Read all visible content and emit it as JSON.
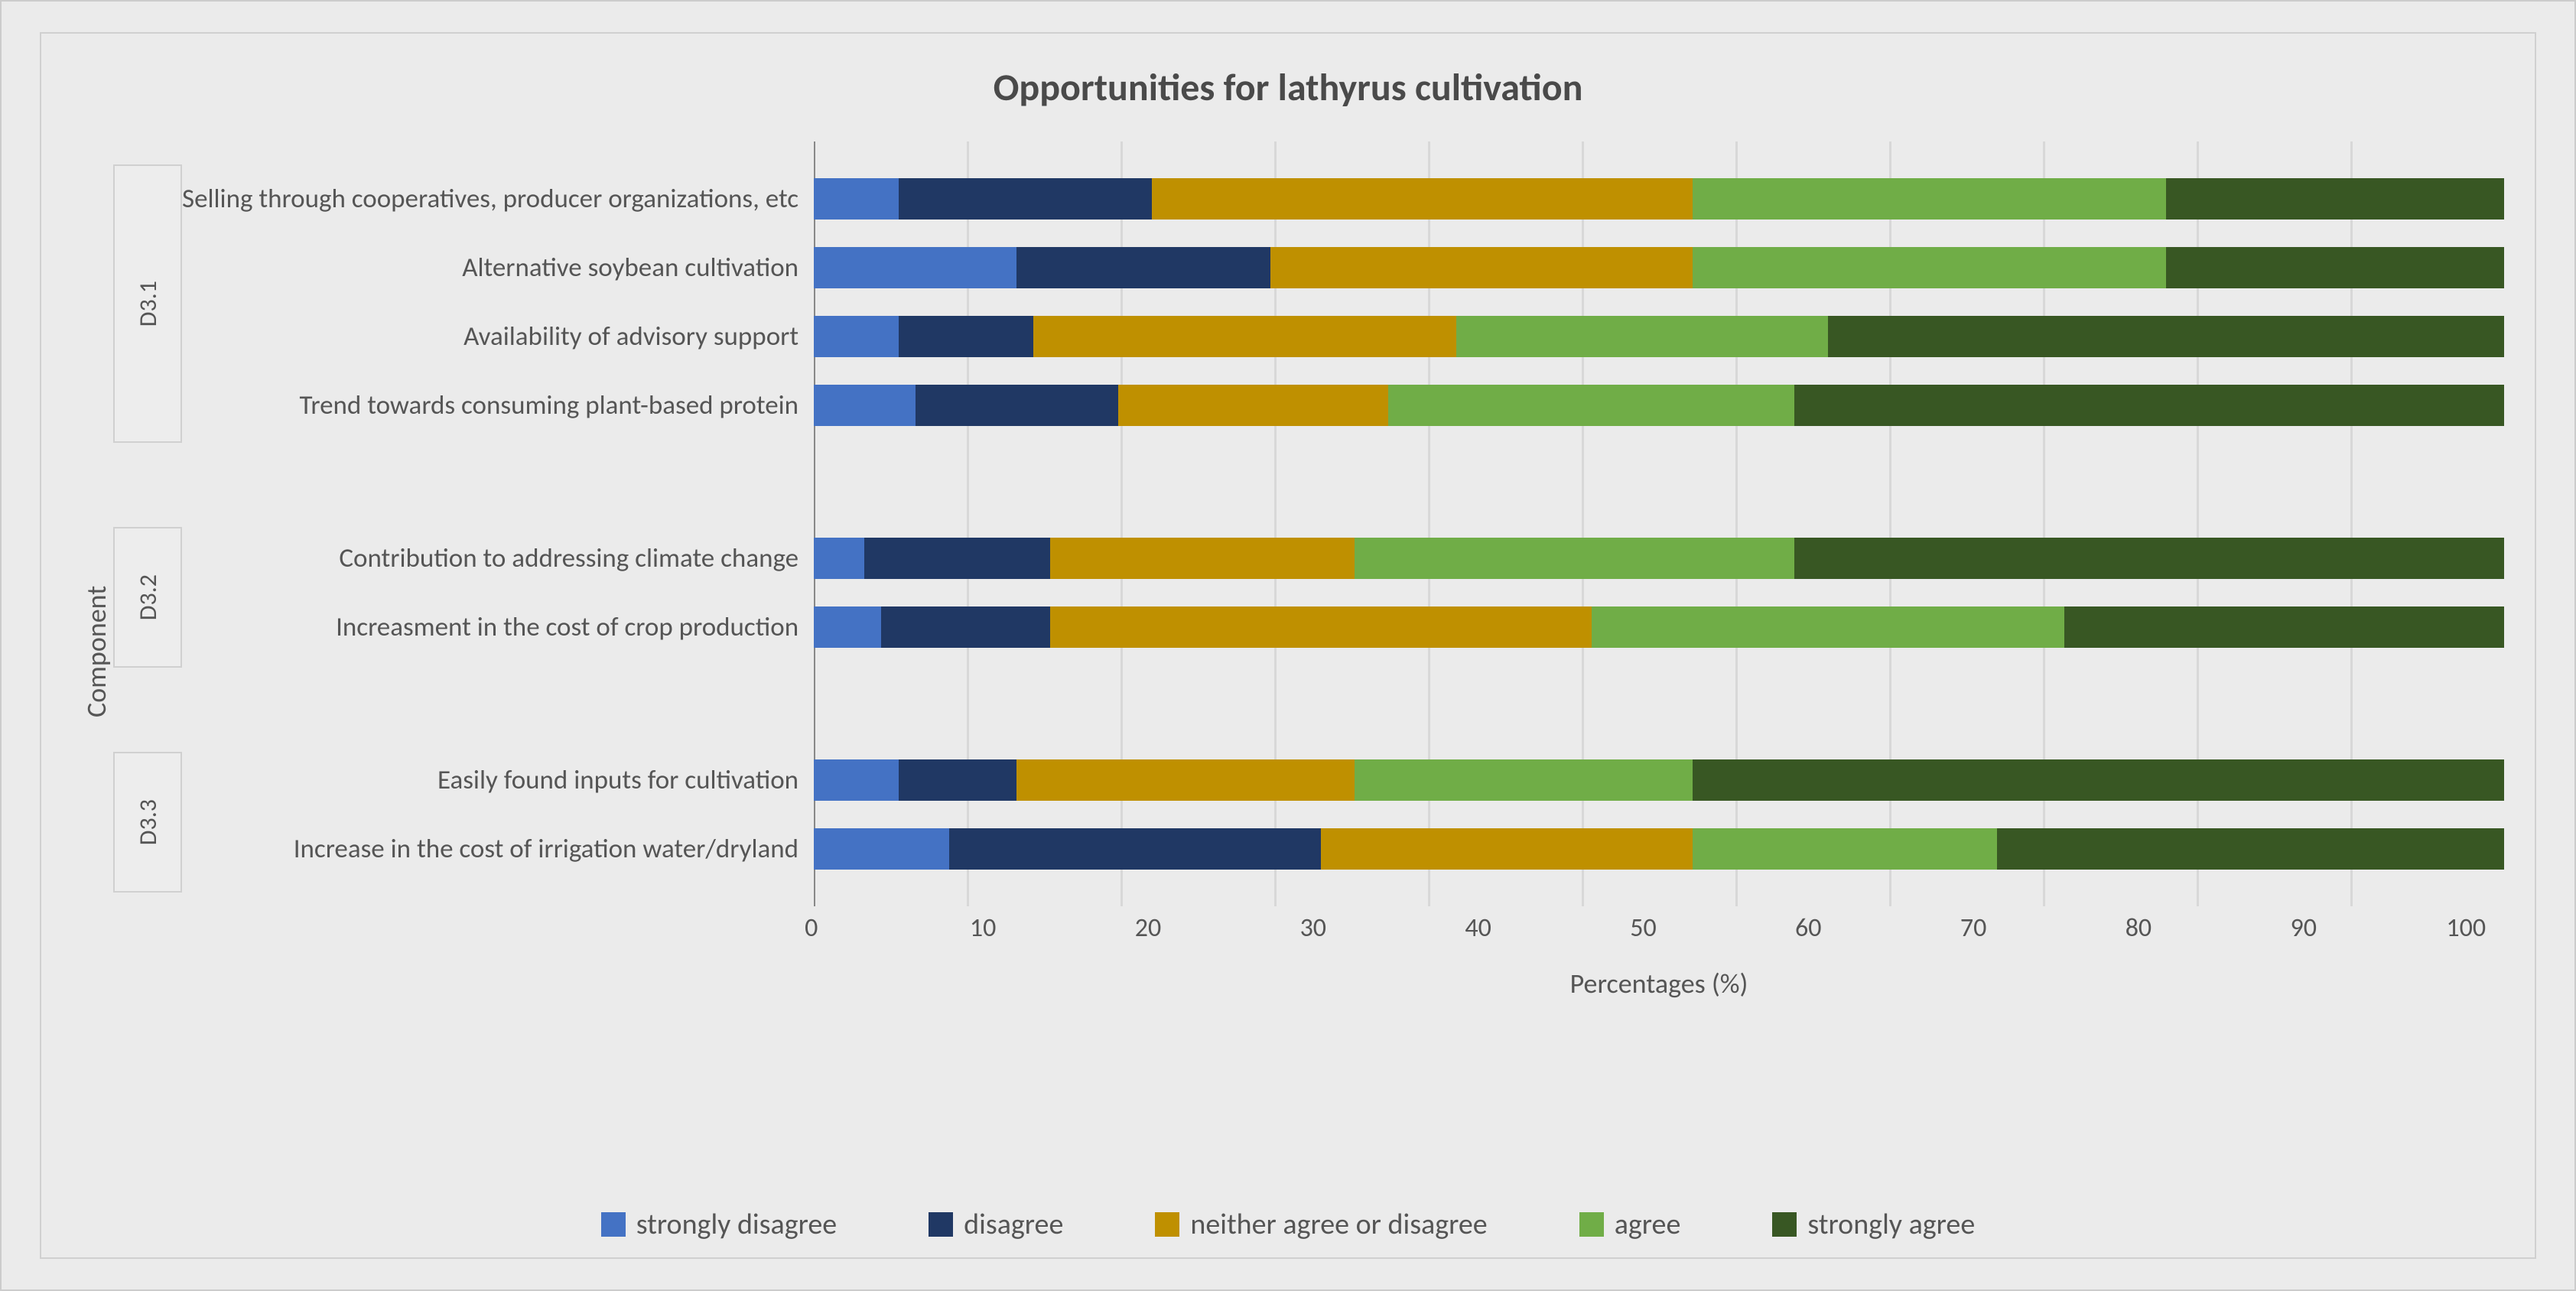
{
  "chart_data": {
    "type": "bar",
    "title": "Opportunities for lathyrus  cultivation",
    "xlabel": "Percentages (%)",
    "ylabel": "Component",
    "xlim": [
      0,
      100
    ],
    "xticks": [
      0,
      10,
      20,
      30,
      40,
      50,
      60,
      70,
      80,
      90,
      100
    ],
    "legend": [
      "strongly disagree",
      "disagree",
      "neither agree or disagree",
      "agree",
      "strongly agree"
    ],
    "colors": [
      "#4472C4",
      "#203864",
      "#BF9000",
      "#70AD47",
      "#385723"
    ],
    "groups": [
      {
        "name": "D3.1",
        "items": [
          {
            "label": "Selling through cooperatives, producer organizations, etc",
            "values": [
              5,
              15,
              32,
              28,
              20
            ]
          },
          {
            "label": "Alternative soybean cultivation",
            "values": [
              12,
              15,
              25,
              28,
              20
            ]
          },
          {
            "label": "Availability of advisory support",
            "values": [
              5,
              8,
              25,
              22,
              40
            ]
          },
          {
            "label": "Trend towards consuming plant-based protein",
            "values": [
              6,
              12,
              16,
              24,
              42
            ]
          }
        ]
      },
      {
        "name": "D3.2",
        "items": [
          {
            "label": "Contribution to addressing climate change",
            "values": [
              3,
              11,
              18,
              26,
              42
            ]
          },
          {
            "label": "Increasment in the cost of crop production",
            "values": [
              4,
              10,
              32,
              28,
              26
            ]
          }
        ]
      },
      {
        "name": "D3.3",
        "items": [
          {
            "label": "Easily found inputs for cultivation",
            "values": [
              5,
              7,
              20,
              20,
              48
            ]
          },
          {
            "label": "Increase in the cost of irrigation water/dryland",
            "values": [
              8,
              22,
              22,
              18,
              30
            ]
          }
        ]
      }
    ]
  }
}
